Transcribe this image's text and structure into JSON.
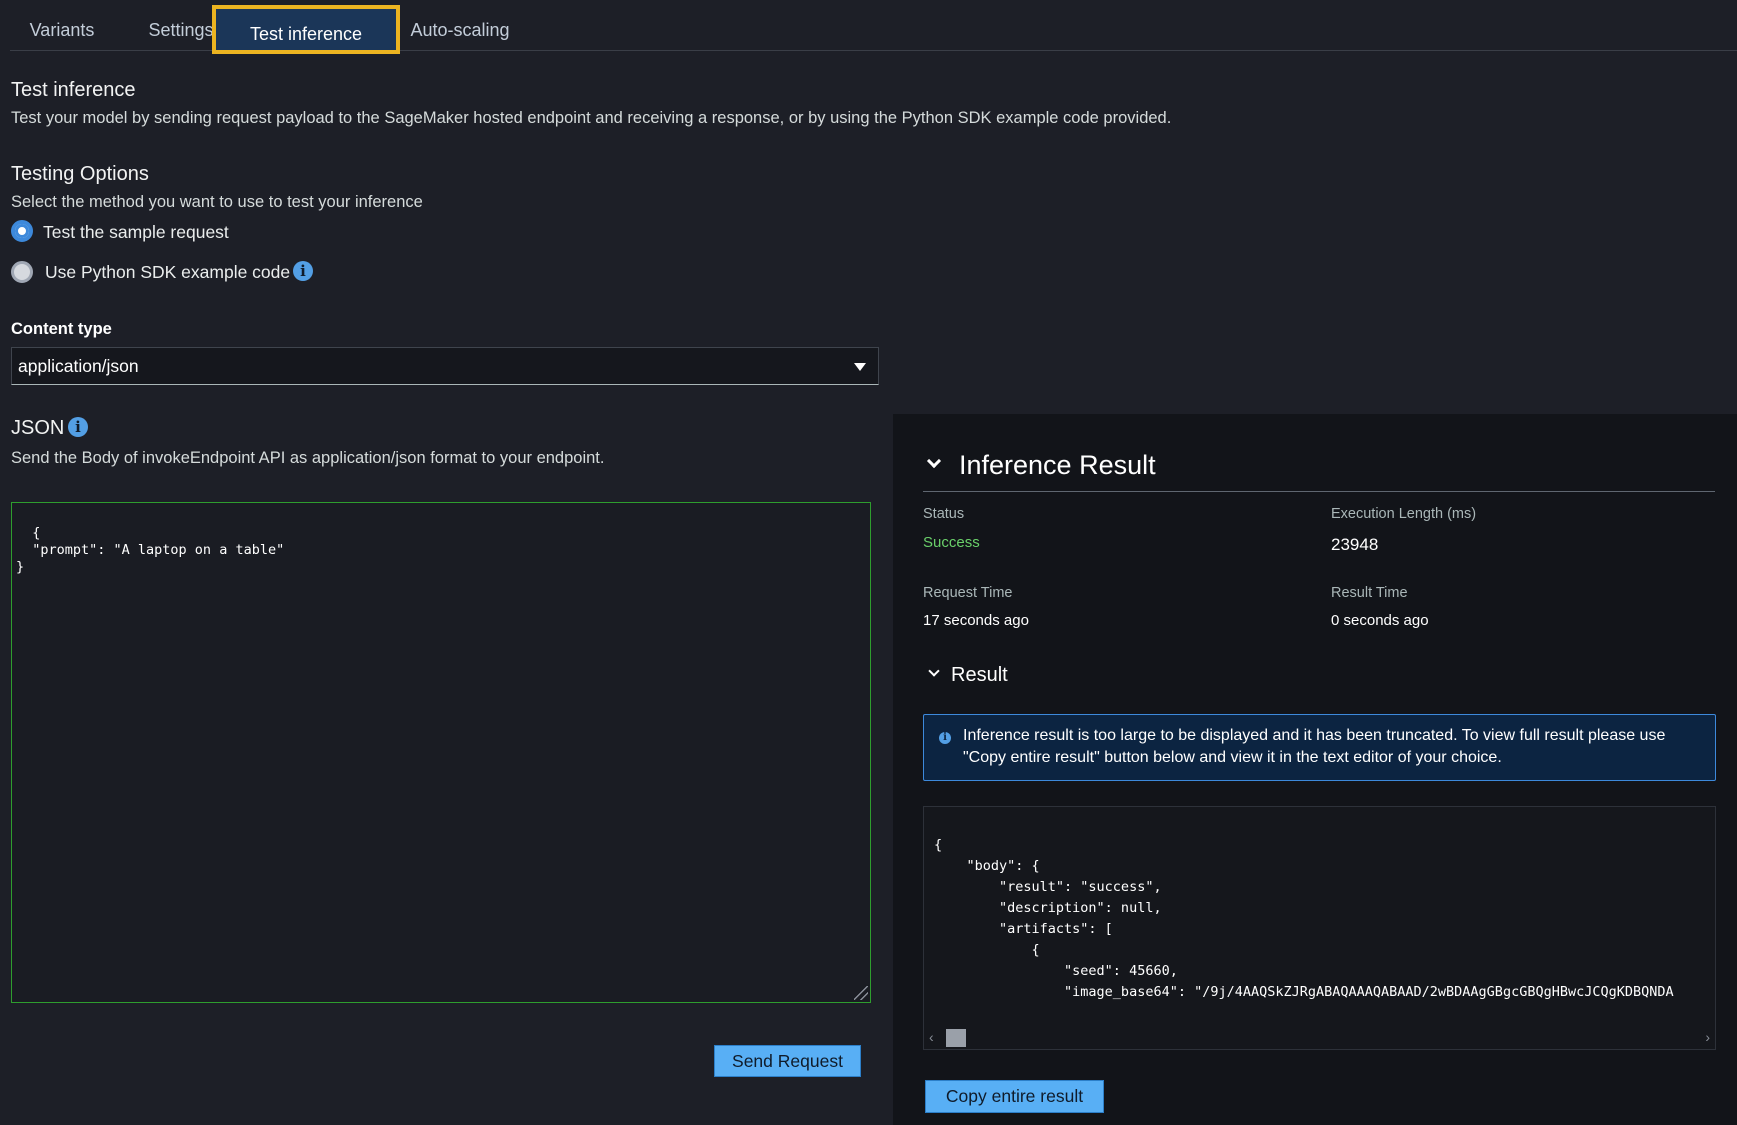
{
  "tabs": [
    {
      "label": "Variants"
    },
    {
      "label": "Settings"
    },
    {
      "label": "Test inference"
    },
    {
      "label": "Auto-scaling"
    }
  ],
  "intro": {
    "title": "Test inference",
    "description": "Test your model by sending request payload to the SageMaker hosted endpoint and receiving a response, or by using the Python SDK example code provided."
  },
  "testing_options": {
    "title": "Testing Options",
    "description": "Select the method you want to use to test your inference",
    "option_sample": "Test the sample request",
    "option_sdk": "Use Python SDK example code",
    "selected": "sample"
  },
  "content_type": {
    "label": "Content type",
    "value": "application/json"
  },
  "json_section": {
    "title": "JSON",
    "description": "Send the Body of invokeEndpoint API as application/json format to your endpoint.",
    "payload": "{\n  \"prompt\": \"A laptop on a table\"\n}"
  },
  "send_button": "Send Request",
  "result_panel": {
    "title": "Inference Result",
    "status_label": "Status",
    "status_value": "Success",
    "exec_label": "Execution Length (ms)",
    "exec_value": "23948",
    "request_time_label": "Request Time",
    "request_time_value": "17 seconds ago",
    "result_time_label": "Result Time",
    "result_time_value": "0 seconds ago",
    "result_section_title": "Result",
    "alert_text": "Inference result is too large to be displayed and it has been truncated. To view full result please use \"Copy entire result\" button below and view it in the text editor of your choice.",
    "result_code": "{\n    \"body\": {\n        \"result\": \"success\",\n        \"description\": null,\n        \"artifacts\": [\n            {\n                \"seed\": 45660,\n                \"image_base64\": \"/9j/4AAQSkZJRgABAQAAAQABAAD/2wBDAAgGBgcGBQgHBwcJCQgKDBQNDA",
    "copy_button": "Copy entire result"
  },
  "colors": {
    "accent": "#539fe5",
    "highlight": "#ecb421",
    "success": "#6ad06a",
    "button": "#58aff5"
  }
}
